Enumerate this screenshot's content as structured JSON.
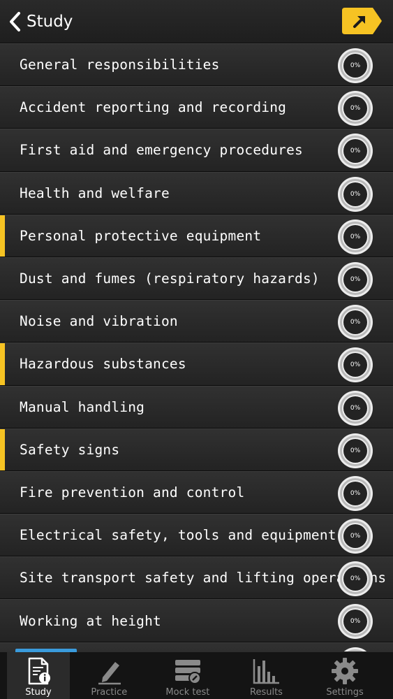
{
  "header": {
    "back_label": "Study",
    "back_icon": "chevron-left-icon",
    "share_icon": "share-arrow-icon",
    "accent_color": "#f6c323"
  },
  "topics": [
    {
      "label": "General responsibilities",
      "progress": "0%",
      "highlighted": false
    },
    {
      "label": "Accident reporting and recording",
      "progress": "0%",
      "highlighted": false
    },
    {
      "label": "First aid and emergency procedures",
      "progress": "0%",
      "highlighted": false
    },
    {
      "label": "Health and welfare",
      "progress": "0%",
      "highlighted": false
    },
    {
      "label": "Personal protective equipment",
      "progress": "0%",
      "highlighted": true
    },
    {
      "label": "Dust and fumes (respiratory hazards)",
      "progress": "0%",
      "highlighted": false
    },
    {
      "label": "Noise and vibration",
      "progress": "0%",
      "highlighted": false
    },
    {
      "label": "Hazardous substances",
      "progress": "0%",
      "highlighted": true
    },
    {
      "label": "Manual handling",
      "progress": "0%",
      "highlighted": false
    },
    {
      "label": "Safety signs",
      "progress": "0%",
      "highlighted": true
    },
    {
      "label": "Fire prevention and control",
      "progress": "0%",
      "highlighted": false
    },
    {
      "label": "Electrical safety, tools and equipment",
      "progress": "0%",
      "highlighted": false
    },
    {
      "label": "Site transport safety and lifting operations",
      "progress": "0%",
      "highlighted": false
    },
    {
      "label": "Working at height",
      "progress": "0%",
      "highlighted": false
    }
  ],
  "tabbar": {
    "active_color": "#3a9bdc",
    "tabs": [
      {
        "label": "Study",
        "icon": "study-document-icon",
        "active": true
      },
      {
        "label": "Practice",
        "icon": "pencil-icon",
        "active": false
      },
      {
        "label": "Mock test",
        "icon": "mock-test-icon",
        "active": false
      },
      {
        "label": "Results",
        "icon": "bar-chart-icon",
        "active": false
      },
      {
        "label": "Settings",
        "icon": "gear-icon",
        "active": false
      }
    ]
  }
}
